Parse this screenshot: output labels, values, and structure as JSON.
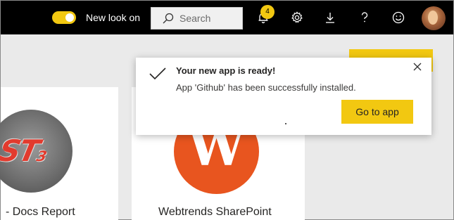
{
  "header": {
    "toggle_label": "New look on",
    "toggle_on": true,
    "search_placeholder": "Search",
    "notification_count": "4",
    "icons": [
      "bell-icon",
      "gear-icon",
      "download-icon",
      "help-icon",
      "smiley-icon"
    ],
    "accent_color": "#f2c811"
  },
  "cards": [
    {
      "title": "- Docs Report",
      "logo": "st-logo"
    },
    {
      "title": "Webtrends SharePoint",
      "logo": "w-logo"
    }
  ],
  "toast": {
    "title": "Your new app is ready!",
    "message": "App 'Github' has been successfully installed.",
    "button_label": "Go to app"
  }
}
